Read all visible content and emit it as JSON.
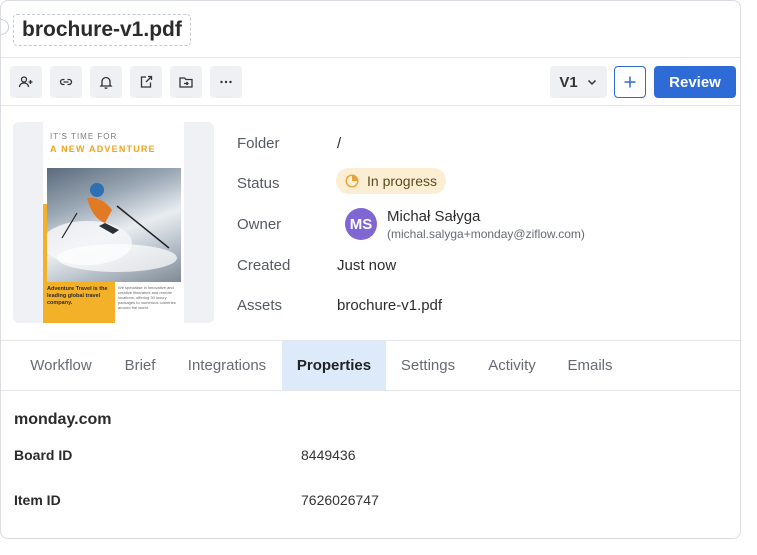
{
  "header": {
    "title": "brochure-v1.pdf"
  },
  "toolbar": {
    "icons": [
      "add-user-icon",
      "link-icon",
      "bell-icon",
      "share-icon",
      "move-to-folder-icon",
      "more-icon"
    ],
    "version_label": "V1",
    "review_label": "Review",
    "accent_color": "#2e6bd6"
  },
  "thumbnail": {
    "line1": "IT'S TIME FOR",
    "line2": "A NEW ADVENTURE",
    "tagline": "Adventure Travel is the leading global travel company.",
    "body": "We specialise in innovative and creative itineraries and remote locations, offering 30 luxury packages to numerous countries around the world."
  },
  "details": {
    "folder": {
      "label": "Folder",
      "value": "/"
    },
    "status": {
      "label": "Status",
      "value": "In progress",
      "color": "#fbeed2"
    },
    "owner": {
      "label": "Owner",
      "initials": "MS",
      "name": "Michał Sałyga",
      "email": "(michal.salyga+monday@ziflow.com)",
      "avatar_color": "#7f66d3"
    },
    "created": {
      "label": "Created",
      "value": "Just now"
    },
    "assets": {
      "label": "Assets",
      "value": "brochure-v1.pdf"
    }
  },
  "tabs": [
    {
      "label": "Workflow",
      "active": false
    },
    {
      "label": "Brief",
      "active": false
    },
    {
      "label": "Integrations",
      "active": false
    },
    {
      "label": "Properties",
      "active": true
    },
    {
      "label": "Settings",
      "active": false
    },
    {
      "label": "Activity",
      "active": false
    },
    {
      "label": "Emails",
      "active": false
    }
  ],
  "properties": {
    "section_title": "monday.com",
    "board_id": {
      "label": "Board ID",
      "value": "8449436"
    },
    "item_id": {
      "label": "Item ID",
      "value": "7626026747"
    }
  }
}
